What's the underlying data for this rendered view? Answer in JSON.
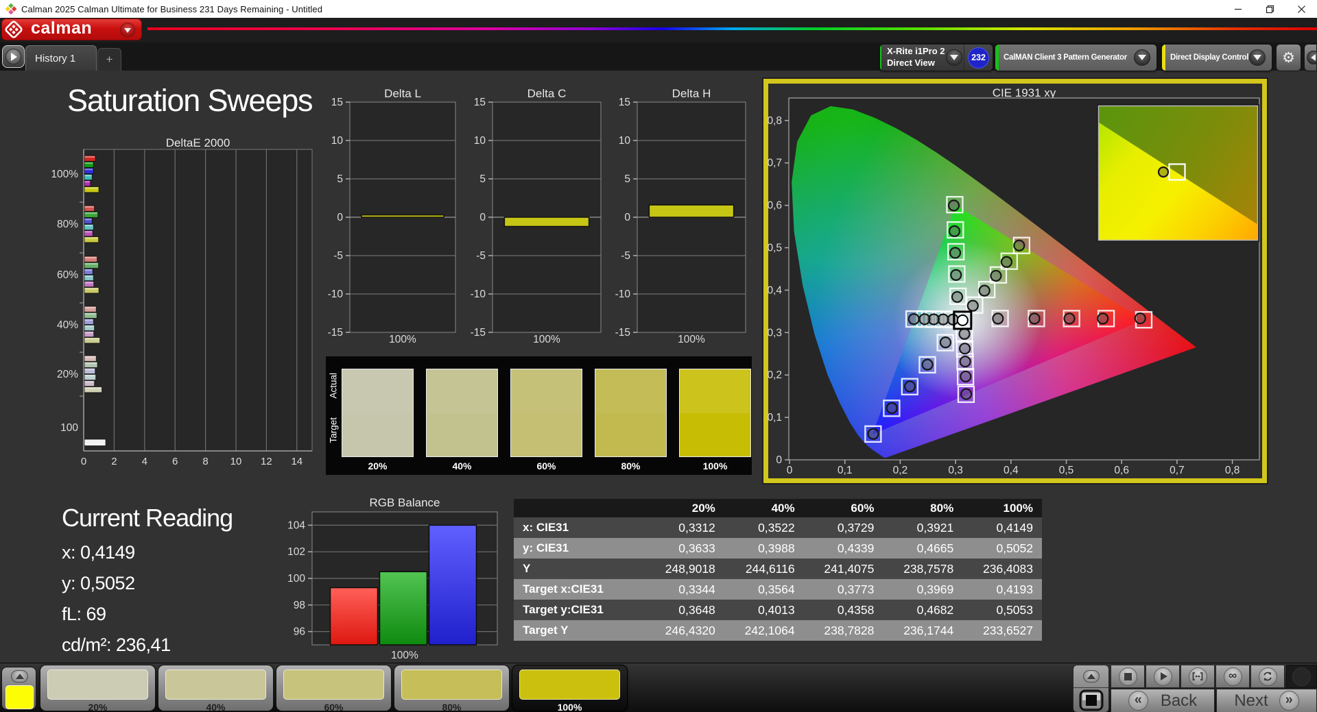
{
  "window": {
    "title": "Calman 2025 Calman Ultimate for Business 231 Days Remaining  - Untitled",
    "controls": {
      "minimize": "minimize",
      "maximize": "maximize",
      "close": "close"
    }
  },
  "brand": {
    "name": "calman"
  },
  "device_bar": {
    "meter": {
      "line1": "X-Rite i1Pro 2",
      "line2": "Direct View"
    },
    "meter_badge": "232",
    "pattern_generator": "CalMAN Client 3 Pattern Generator",
    "display_control": "Direct Display Control"
  },
  "tab_bar": {
    "active_tab": "History 1",
    "add_tab": "+"
  },
  "page": {
    "title": "Saturation Sweeps"
  },
  "current_reading": {
    "title": "Current Reading",
    "lines": [
      "x: 0,4149",
      "y: 0,5052",
      "fL: 69",
      "cd/m²: 236,41"
    ]
  },
  "chart_data": [
    {
      "id": "deltae2000",
      "type": "bar",
      "orientation": "horizontal",
      "title": "DeltaE 2000",
      "xlabel": "",
      "ylabel": "",
      "xlim": [
        0,
        15
      ],
      "x_ticks": [
        0,
        2,
        4,
        6,
        8,
        10,
        12,
        14
      ],
      "grid": true,
      "legend_position": "none",
      "series_order": [
        "red",
        "green",
        "blue",
        "cyan",
        "magenta",
        "yellow"
      ],
      "groups": [
        {
          "label": "100%",
          "values": [
            0.73,
            0.6,
            0.6,
            0.51,
            0.4,
            0.95
          ],
          "colors": [
            "#d22a24",
            "#159a15",
            "#2f2fd4",
            "#3dbdbd",
            "#b42ab4",
            "#c6c614"
          ]
        },
        {
          "label": "80%",
          "values": [
            0.66,
            0.89,
            0.51,
            0.6,
            0.55,
            0.93
          ],
          "colors": [
            "#d4554f",
            "#3aa83a",
            "#5252d8",
            "#62c2c2",
            "#bb50bb",
            "#c9c93e"
          ]
        },
        {
          "label": "60%",
          "values": [
            0.84,
            0.93,
            0.55,
            0.6,
            0.62,
            0.95
          ],
          "colors": [
            "#d77e78",
            "#68b268",
            "#7c7cd8",
            "#86c6c6",
            "#c276c2",
            "#caca68"
          ]
        },
        {
          "label": "40%",
          "values": [
            0.78,
            0.82,
            0.6,
            0.66,
            0.62,
            1.02
          ],
          "colors": [
            "#d8a09c",
            "#92be92",
            "#9d9dd8",
            "#a4cbcb",
            "#c89ac8",
            "#cccc90"
          ]
        },
        {
          "label": "20%",
          "values": [
            0.78,
            0.86,
            0.71,
            0.75,
            0.66,
            1.15
          ],
          "colors": [
            "#d8bcba",
            "#b2c7b2",
            "#bcbcd8",
            "#bed0d0",
            "#cbb9cb",
            "#cfcfb2"
          ]
        }
      ],
      "luminance_group": {
        "label": "100",
        "value": 1.4,
        "color": "#f2f2f2"
      }
    },
    {
      "id": "delta_l",
      "type": "bar",
      "title": "Delta L",
      "categories": [
        "100%"
      ],
      "values": [
        0.3
      ],
      "ylim": [
        -15,
        15
      ],
      "y_ticks": [
        15,
        10,
        5,
        0,
        -5,
        -10,
        -15
      ],
      "bar_color": "#c6c615",
      "grid": true
    },
    {
      "id": "delta_c",
      "type": "bar",
      "title": "Delta C",
      "categories": [
        "100%"
      ],
      "values": [
        -1.2
      ],
      "ylim": [
        -15,
        15
      ],
      "y_ticks": [
        15,
        10,
        5,
        0,
        -5,
        -10,
        -15
      ],
      "bar_color": "#c6c615",
      "grid": true
    },
    {
      "id": "delta_h",
      "type": "bar",
      "title": "Delta H",
      "categories": [
        "100%"
      ],
      "values": [
        1.6
      ],
      "ylim": [
        -15,
        15
      ],
      "y_ticks": [
        15,
        10,
        5,
        0,
        -5,
        -10,
        -15
      ],
      "bar_color": "#c6c615",
      "grid": true
    },
    {
      "id": "saturation_swatches",
      "type": "swatch-compare",
      "row_labels": [
        "Actual",
        "Target"
      ],
      "levels": [
        {
          "label": "20%",
          "actual": "#c8c8b1",
          "target": "#c6c6ac"
        },
        {
          "label": "40%",
          "actual": "#c4c495",
          "target": "#c2c28e"
        },
        {
          "label": "60%",
          "actual": "#c6c178",
          "target": "#c4bf72"
        },
        {
          "label": "80%",
          "actual": "#c3bc57",
          "target": "#c2ba4e"
        },
        {
          "label": "100%",
          "actual": "#cdc31d",
          "target": "#c7bd04"
        }
      ]
    },
    {
      "id": "cie1931",
      "type": "scatter",
      "title": "CIE 1931 xy",
      "xlim": [
        0,
        0.849
      ],
      "ylim": [
        0,
        0.853
      ],
      "tick_step": 0.1,
      "x_tick_labels": [
        "0",
        "0,1",
        "0,2",
        "0,3",
        "0,4",
        "0,5",
        "0,6",
        "0,7",
        "0,8"
      ],
      "y_tick_labels": [
        "0",
        "0,1",
        "0,2",
        "0,3",
        "0,4",
        "0,5",
        "0,6",
        "0,7",
        "0,8"
      ],
      "white_point": {
        "x": 0.3127,
        "y": 0.329
      },
      "gamut_triangle": {
        "red": [
          0.64,
          0.33
        ],
        "green": [
          0.3,
          0.6
        ],
        "blue": [
          0.15,
          0.06
        ]
      },
      "sweeps": [
        {
          "name": "red",
          "target": [
            [
              0.3805,
              0.3332
            ],
            [
              0.446,
              0.3331
            ],
            [
              0.5095,
              0.333
            ],
            [
              0.572,
              0.333
            ],
            [
              0.64,
              0.33
            ]
          ],
          "measured": [
            [
              0.3765,
              0.333
            ],
            [
              0.4425,
              0.333
            ],
            [
              0.5055,
              0.333
            ],
            [
              0.566,
              0.333
            ],
            [
              0.6335,
              0.3335
            ]
          ]
        },
        {
          "name": "green",
          "target": [
            [
              0.3045,
              0.3855
            ],
            [
              0.3022,
              0.438
            ],
            [
              0.3007,
              0.4905
            ],
            [
              0.2996,
              0.542
            ],
            [
              0.2985,
              0.6015
            ]
          ],
          "measured": [
            [
              0.303,
              0.384
            ],
            [
              0.3008,
              0.4358
            ],
            [
              0.2993,
              0.488
            ],
            [
              0.298,
              0.539
            ],
            [
              0.2968,
              0.5995
            ]
          ]
        },
        {
          "name": "blue",
          "target": [
            [
              0.2815,
              0.2762
            ],
            [
              0.249,
              0.224
            ],
            [
              0.2172,
              0.1725
            ],
            [
              0.1845,
              0.1215
            ],
            [
              0.151,
              0.0608
            ]
          ],
          "measured": [
            [
              0.2818,
              0.2768
            ],
            [
              0.2492,
              0.2245
            ],
            [
              0.2175,
              0.173
            ],
            [
              0.1848,
              0.122
            ],
            [
              0.1512,
              0.0612
            ]
          ]
        },
        {
          "name": "cyan",
          "target": [
            [
              0.2955,
              0.331
            ],
            [
              0.278,
              0.3313
            ],
            [
              0.261,
              0.3315
            ],
            [
              0.2445,
              0.3318
            ],
            [
              0.225,
              0.332
            ]
          ],
          "measured": [
            [
              0.2952,
              0.3308
            ],
            [
              0.2776,
              0.331
            ],
            [
              0.2606,
              0.3312
            ],
            [
              0.244,
              0.3315
            ],
            [
              0.2246,
              0.3318
            ]
          ]
        },
        {
          "name": "magenta",
          "target": [
            [
              0.3158,
              0.2962
            ],
            [
              0.3165,
              0.2618
            ],
            [
              0.3172,
              0.2312
            ],
            [
              0.318,
              0.196
            ],
            [
              0.319,
              0.1545
            ]
          ],
          "measured": [
            [
              0.316,
              0.2968
            ],
            [
              0.3167,
              0.2622
            ],
            [
              0.3174,
              0.2316
            ],
            [
              0.3182,
              0.1964
            ],
            [
              0.3192,
              0.155
            ]
          ]
        },
        {
          "name": "yellow",
          "target": [
            [
              0.3344,
              0.3648
            ],
            [
              0.3564,
              0.4013
            ],
            [
              0.3773,
              0.4358
            ],
            [
              0.3969,
              0.4682
            ],
            [
              0.4193,
              0.5053
            ]
          ],
          "measured": [
            [
              0.3312,
              0.3633
            ],
            [
              0.3522,
              0.3988
            ],
            [
              0.3729,
              0.4339
            ],
            [
              0.3921,
              0.4665
            ],
            [
              0.4149,
              0.5052
            ]
          ]
        }
      ],
      "inset": {
        "measured": [
          0.4149,
          0.5052
        ],
        "target": [
          0.4193,
          0.5053
        ]
      }
    },
    {
      "id": "rgb_balance",
      "type": "bar",
      "title": "RGB Balance",
      "categories": [
        "100%"
      ],
      "ylim": [
        95,
        105
      ],
      "y_ticks": [
        96,
        98,
        100,
        102,
        104
      ],
      "series": [
        {
          "name": "Red",
          "value": 99.3,
          "color_top": "#ff6058",
          "color_bottom": "#dd1810"
        },
        {
          "name": "Green",
          "value": 100.5,
          "color_top": "#52c452",
          "color_bottom": "#0f8a0f"
        },
        {
          "name": "Blue",
          "value": 104.0,
          "color_top": "#6060ff",
          "color_bottom": "#2020cc"
        }
      ],
      "grid": true
    },
    {
      "id": "readings_table",
      "type": "table",
      "headers": [
        "",
        "20%",
        "40%",
        "60%",
        "80%",
        "100%"
      ],
      "rows": [
        {
          "label": "x: CIE31",
          "values": [
            "0,3312",
            "0,3522",
            "0,3729",
            "0,3921",
            "0,4149"
          ]
        },
        {
          "label": "y: CIE31",
          "values": [
            "0,3633",
            "0,3988",
            "0,4339",
            "0,4665",
            "0,5052"
          ]
        },
        {
          "label": "Y",
          "values": [
            "248,9018",
            "244,6116",
            "241,4075",
            "238,7578",
            "236,4083"
          ]
        },
        {
          "label": "Target x:CIE31",
          "values": [
            "0,3344",
            "0,3564",
            "0,3773",
            "0,3969",
            "0,4193"
          ]
        },
        {
          "label": "Target y:CIE31",
          "values": [
            "0,3648",
            "0,4013",
            "0,4358",
            "0,4682",
            "0,5053"
          ]
        },
        {
          "label": "Target Y",
          "values": [
            "246,4320",
            "242,1064",
            "238,7828",
            "236,1744",
            "233,6527"
          ]
        }
      ]
    }
  ],
  "bottom_bar": {
    "quick_patch_color": "#fdfd05",
    "patches": [
      {
        "label": "20%",
        "color": "#ccccb4",
        "active": false
      },
      {
        "label": "40%",
        "color": "#c9c79a",
        "active": false
      },
      {
        "label": "60%",
        "color": "#c8c37c",
        "active": false
      },
      {
        "label": "80%",
        "color": "#c5be59",
        "active": false
      },
      {
        "label": "100%",
        "color": "#cbc00d",
        "active": true
      }
    ],
    "back_label": "Back",
    "next_label": "Next"
  }
}
